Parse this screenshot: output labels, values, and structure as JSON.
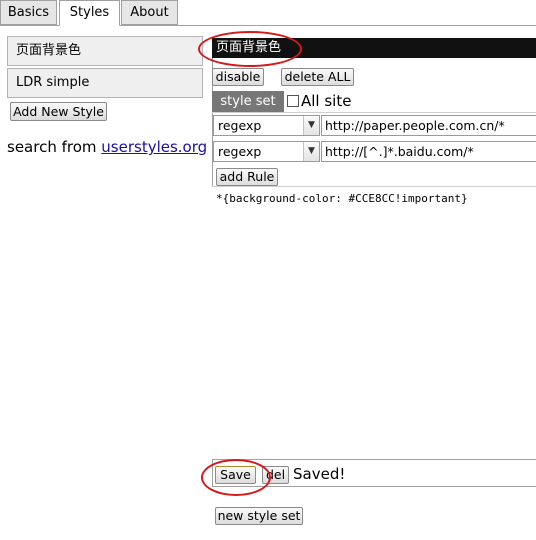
{
  "tabs": [
    {
      "label": "Basics",
      "active": false
    },
    {
      "label": "Styles",
      "active": true
    },
    {
      "label": "About",
      "active": false
    }
  ],
  "styles_list": {
    "items": [
      {
        "label": "页面背景色"
      },
      {
        "label": "LDR simple"
      }
    ],
    "add_button": "Add New Style"
  },
  "search": {
    "prefix": "search from ",
    "link": "userstyles.org"
  },
  "editor_panel": {
    "style_name": "页面背景色",
    "disable_button": "disable",
    "delete_all_button": "delete ALL",
    "style_set_label": "style set",
    "all_site_label": "All site",
    "all_site_checked": false,
    "rules": [
      {
        "type": "regexp",
        "pattern": "http://paper.people.com.cn/*"
      },
      {
        "type": "regexp",
        "pattern": "http://[^.]*.baidu.com/*"
      }
    ],
    "add_rule_button": "add Rule",
    "css_code": "*{background-color: #CCE8CC!important}",
    "save_button": "Save",
    "del_button": "del",
    "status": "Saved!",
    "new_style_set_button": "new style set"
  },
  "colors": {
    "highlight_circle": "#d41a1a",
    "name_bar": "#111111",
    "style_set_bg": "#777777",
    "link": "#1a0dab"
  }
}
